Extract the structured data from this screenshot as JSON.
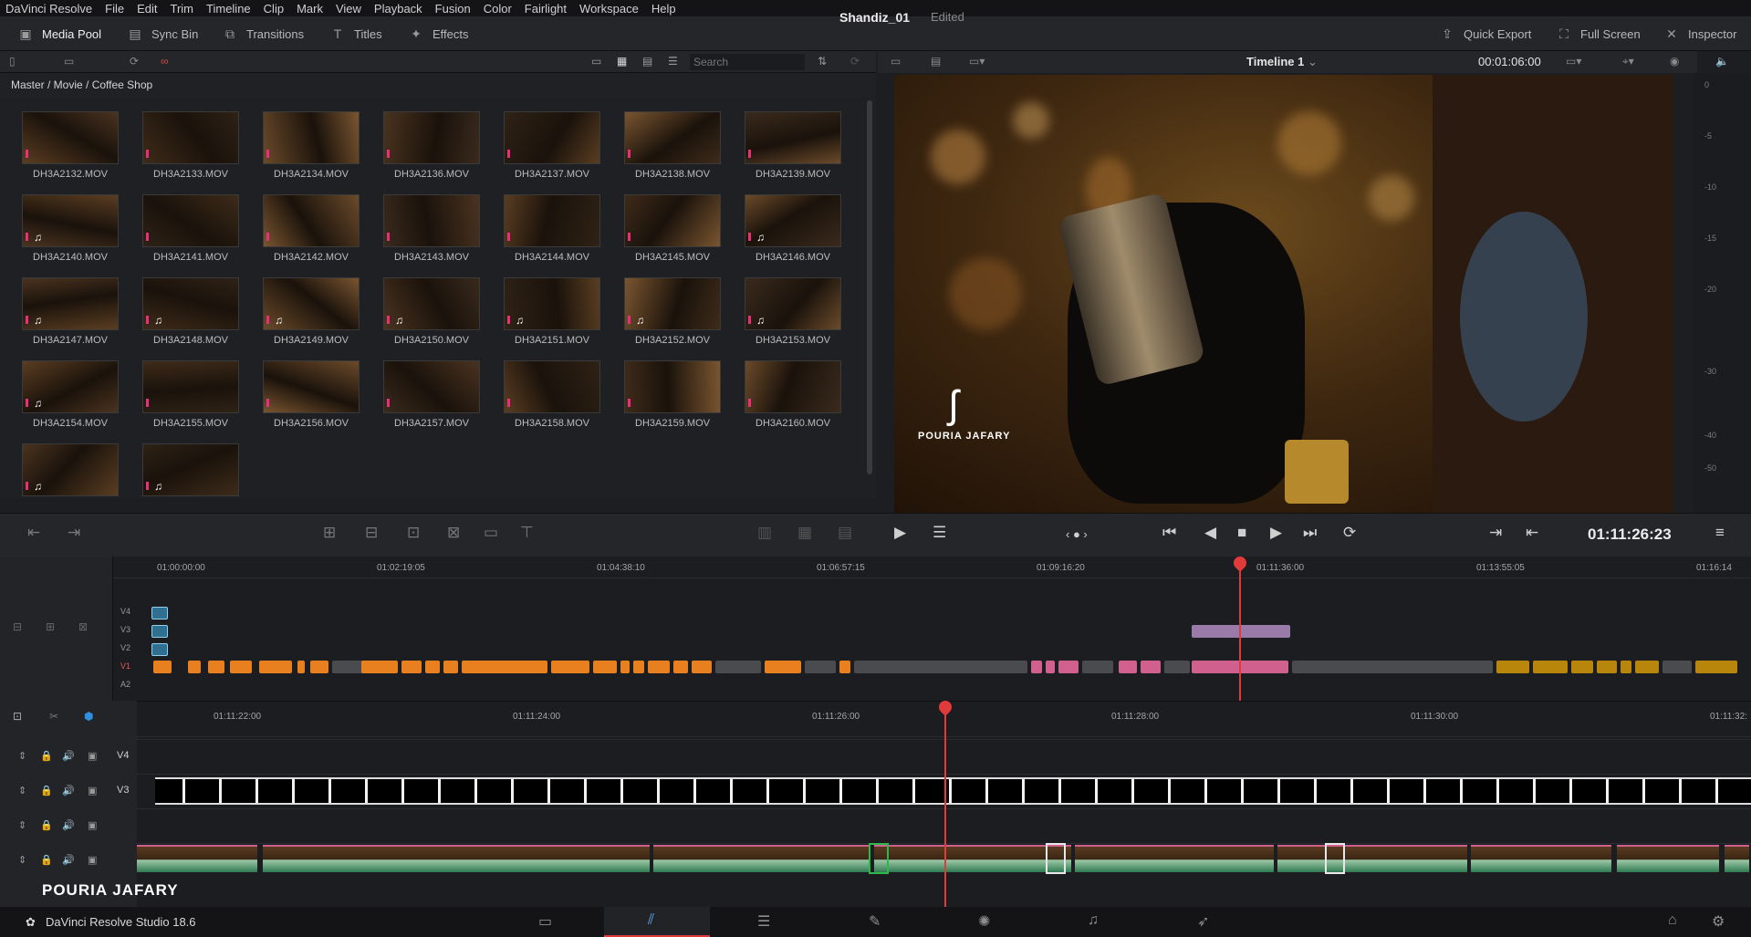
{
  "menu": [
    "DaVinci Resolve",
    "File",
    "Edit",
    "Trim",
    "Timeline",
    "Clip",
    "Mark",
    "View",
    "Playback",
    "Fusion",
    "Color",
    "Fairlight",
    "Workspace",
    "Help"
  ],
  "toolbar": {
    "media_pool": "Media Pool",
    "sync_bin": "Sync Bin",
    "transitions": "Transitions",
    "titles": "Titles",
    "effects": "Effects",
    "quick_export": "Quick Export",
    "full_screen": "Full Screen",
    "inspector": "Inspector"
  },
  "project": {
    "name": "Shandiz_01",
    "status": "Edited"
  },
  "pool": {
    "search_placeholder": "Search",
    "breadcrumb": "Master / Movie / Coffee Shop",
    "clips": [
      "DH3A2132.MOV",
      "DH3A2133.MOV",
      "DH3A2134.MOV",
      "DH3A2136.MOV",
      "DH3A2137.MOV",
      "DH3A2138.MOV",
      "DH3A2139.MOV",
      "DH3A2140.MOV",
      "DH3A2141.MOV",
      "DH3A2142.MOV",
      "DH3A2143.MOV",
      "DH3A2144.MOV",
      "DH3A2145.MOV",
      "DH3A2146.MOV",
      "DH3A2147.MOV",
      "DH3A2148.MOV",
      "DH3A2149.MOV",
      "DH3A2150.MOV",
      "DH3A2151.MOV",
      "DH3A2152.MOV",
      "DH3A2153.MOV",
      "DH3A2154.MOV",
      "DH3A2155.MOV",
      "DH3A2156.MOV",
      "DH3A2157.MOV",
      "DH3A2158.MOV",
      "DH3A2159.MOV",
      "DH3A2160.MOV",
      "",
      ""
    ]
  },
  "viewer": {
    "timeline_name": "Timeline 1",
    "duration": "00:01:06:00",
    "timecode": "01:11:26:23",
    "watermark": "POURIA JAFARY",
    "meter_scale": [
      "0",
      "-5",
      "-10",
      "-15",
      "-20",
      "-30",
      "-40",
      "-50"
    ]
  },
  "mini_timeline": {
    "ruler": [
      "01:00:00:00",
      "01:02:19:05",
      "01:04:38:10",
      "01:06:57:15",
      "01:09:16:20",
      "01:11:36:00",
      "01:13:55:05",
      "01:16:14"
    ],
    "tracks": [
      "V4",
      "V3",
      "V2",
      "V1",
      "A2"
    ]
  },
  "main_timeline": {
    "ruler": [
      "01:11:22:00",
      "01:11:24:00",
      "01:11:26:00",
      "01:11:28:00",
      "01:11:30:00",
      "01:11:32:"
    ],
    "tracks": [
      "V4",
      "V3",
      "",
      ""
    ],
    "watermark": "POURIA JAFARY"
  },
  "statusbar": {
    "app": "DaVinci Resolve Studio 18.6"
  },
  "colors": {
    "accent_orange": "#e8801f",
    "pink": "#d0608e",
    "gold": "#b8860b",
    "playhead": "#e03a3a",
    "audio_green": "#2f7a52"
  }
}
